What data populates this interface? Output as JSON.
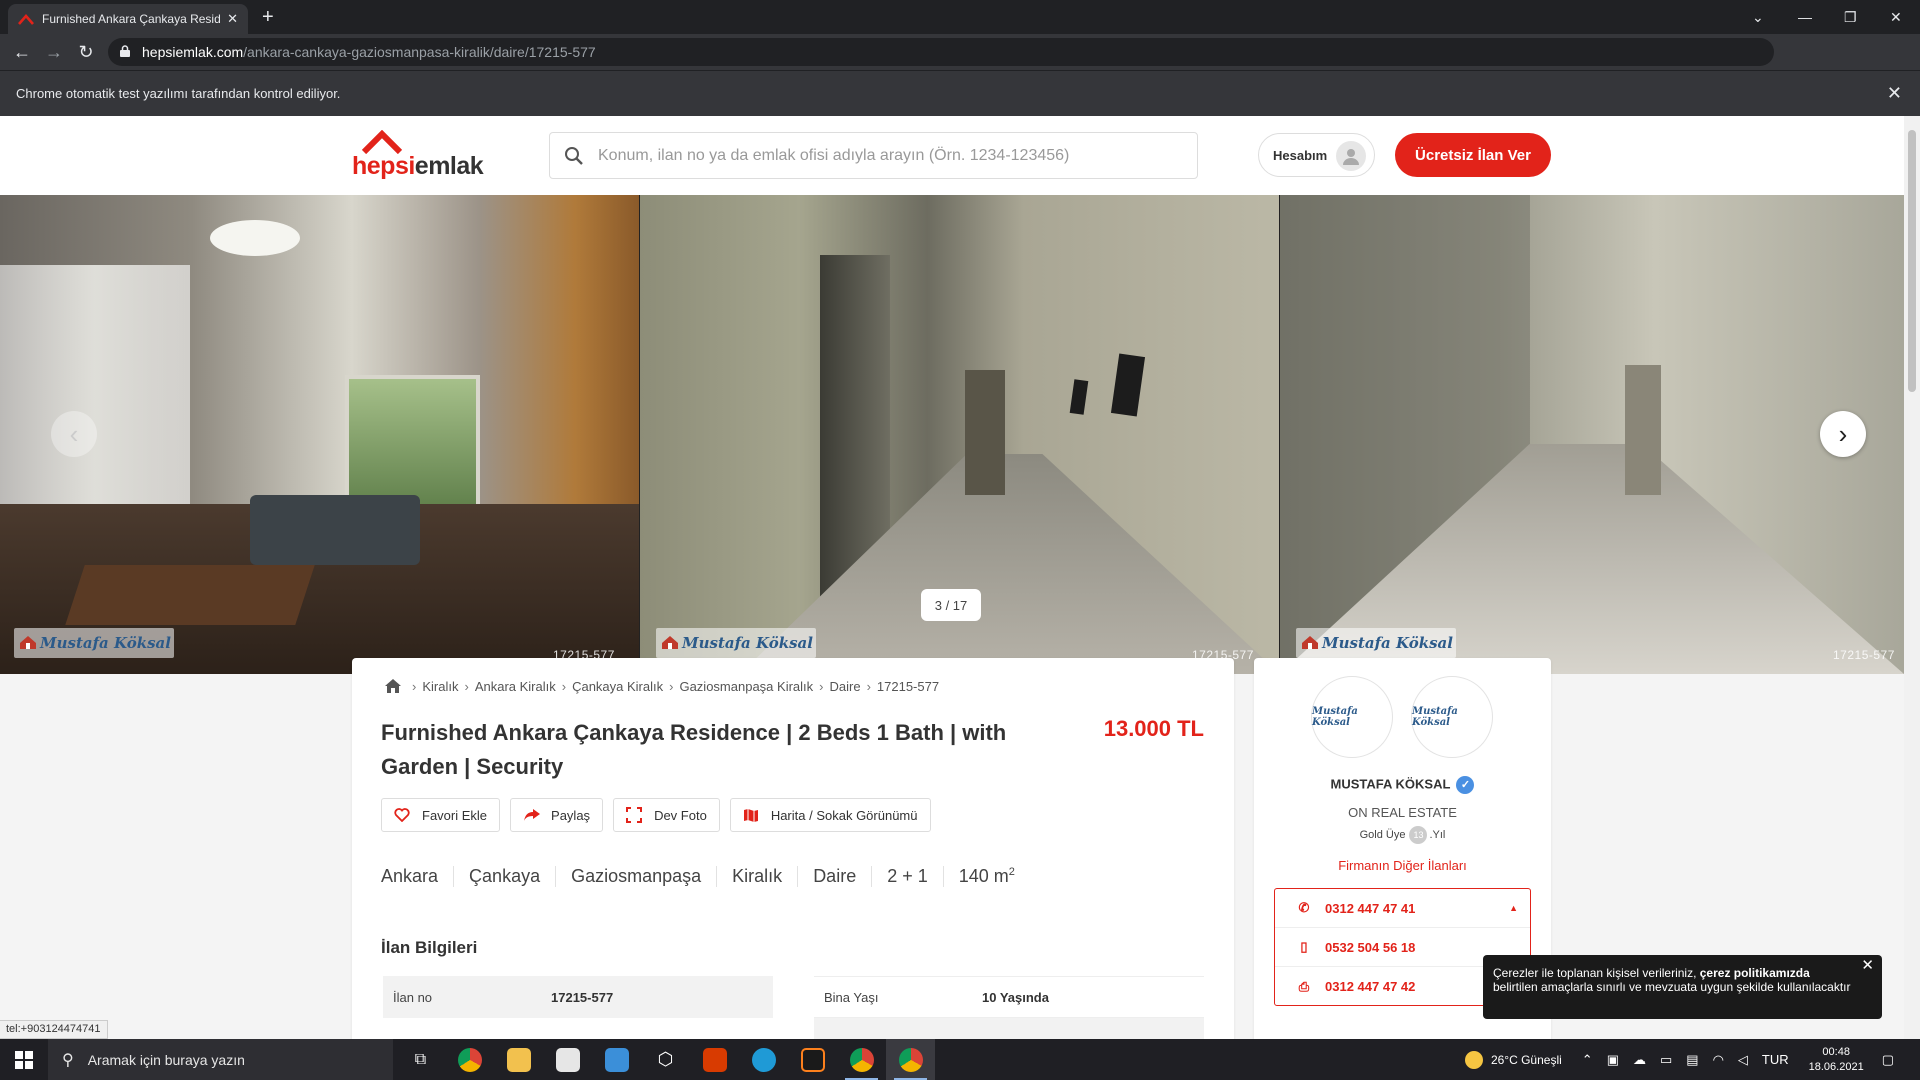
{
  "browser": {
    "tab_title": "Furnished Ankara Çankaya Reside",
    "new_tab": "+",
    "url_host": "hepsiemlak.com",
    "url_path": "/ankara-cankaya-gaziosmanpasa-kiralik/daire/17215-577",
    "infobar_text": "Chrome otomatik test yazılımı tarafından kontrol ediliyor."
  },
  "header": {
    "logo_red": "hepsi",
    "logo_dark": "emlak",
    "search_placeholder": "Konum, ilan no ya da emlak ofisi adıyla arayın (Örn. 1234-123456)",
    "account_label": "Hesabım",
    "cta_label": "Ücretsiz İlan Ver"
  },
  "gallery": {
    "counter": "3 / 17",
    "watermark": "Mustafa Köksal",
    "id_tag": "17215-577"
  },
  "listing": {
    "breadcrumbs": [
      "Kiralık",
      "Ankara Kiralık",
      "Çankaya Kiralık",
      "Gaziosmanpaşa Kiralık",
      "Daire",
      "17215-577"
    ],
    "title": "Furnished Ankara Çankaya Residence | 2 Beds 1 Bath | with Garden | Security",
    "price": "13.000 TL",
    "actions": {
      "favorite": "Favori Ekle",
      "share": "Paylaş",
      "big_photo": "Dev Foto",
      "map": "Harita / Sokak Görünümü"
    },
    "specs": {
      "city": "Ankara",
      "district": "Çankaya",
      "neighborhood": "Gaziosmanpaşa",
      "type": "Kiralık",
      "category": "Daire",
      "rooms": "2 + 1",
      "area": "140 m",
      "area_sup": "2"
    },
    "info_heading": "İlan Bilgileri",
    "info": {
      "ilan_no_label": "İlan no",
      "ilan_no": "17215-577",
      "building_age_label": "Bina Yaşı",
      "building_age": "10 Yaşında"
    }
  },
  "agent": {
    "logo_text": "Mustafa Köksal",
    "name": "MUSTAFA KÖKSAL",
    "company": "ON REAL ESTATE",
    "membership": "Gold Üye",
    "years": "13",
    "years_suffix": ".Yıl",
    "other_listings": "Firmanın Diğer İlanları",
    "phones": [
      "0312 447 47 41",
      "0532 504 56 18",
      "0312 447 47 42"
    ]
  },
  "cookie": {
    "text_before": "Çerezler ile toplanan kişisel verileriniz, ",
    "text_bold": "çerez politikamızda",
    "text_after": " belirtilen amaçlarla sınırlı ve mevzuata uygun şekilde kullanılacaktır"
  },
  "statusbar": "tel:+903124474741",
  "taskbar": {
    "search_placeholder": "Aramak için buraya yazın",
    "weather": "26°C  Güneşli",
    "lang": "TUR",
    "time": "00:48",
    "date": "18.06.2021"
  },
  "colors": {
    "brand_red": "#e2231a",
    "verified_blue": "#4a90e2"
  }
}
